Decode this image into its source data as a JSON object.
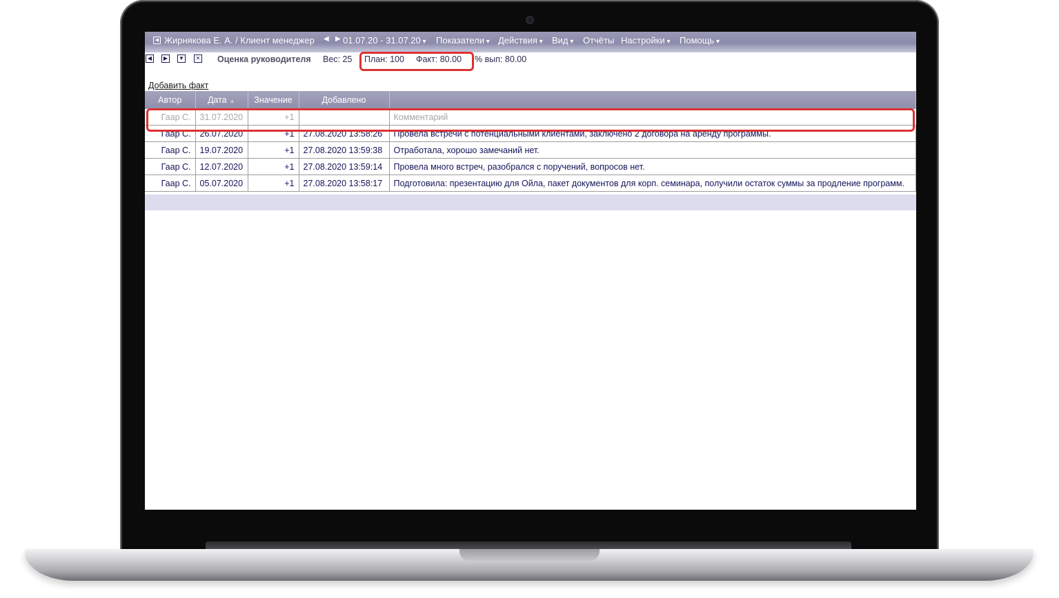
{
  "topbar": {
    "user_title": "Жирнякова Е. А. / Клиент менеджер",
    "period": "01.07.20 - 31.07.20",
    "menu": [
      "Показатели",
      "Действия",
      "Вид",
      "Отчёты",
      "Настройки",
      "Помощь"
    ]
  },
  "indicator": {
    "name": "Оценка руководителя",
    "weight_label": "Вес: 25",
    "plan_label": "План: 100",
    "fact_label": "Факт: 80.00",
    "percent_label": "% вып: 80.00"
  },
  "add_fact_label": "Добавить факт",
  "table": {
    "columns": [
      "Автор",
      "Дата",
      "Значение",
      "Добавлено",
      ""
    ],
    "draft_row": {
      "author": "Гаар С.",
      "date": "31.07.2020",
      "value": "+1",
      "added": "",
      "comment_placeholder": "Комментарий"
    },
    "rows": [
      {
        "author": "Гаар С.",
        "date": "26.07.2020",
        "value": "+1",
        "added": "27.08.2020 13:58:26",
        "comment": "Провела встречи с потенциальными клиентами, заключено 2 договора на аренду программы."
      },
      {
        "author": "Гаар С.",
        "date": "19.07.2020",
        "value": "+1",
        "added": "27.08.2020 13:59:38",
        "comment": "Отработала, хорошо замечаний нет."
      },
      {
        "author": "Гаар С.",
        "date": "12.07.2020",
        "value": "+1",
        "added": "27.08.2020 13:59:14",
        "comment": "Провела много встреч, разобрался с поручений, вопросов нет."
      },
      {
        "author": "Гаар С.",
        "date": "05.07.2020",
        "value": "+1",
        "added": "27.08.2020 13:58:17",
        "comment": "Подготовила: презентацию для Ойла, пакет документов для корп. семинара, получили остаток суммы за продление программ."
      }
    ]
  },
  "colors": {
    "highlight": "#dc3232",
    "header_bar": "#8f8fad",
    "text": "#14145a"
  }
}
